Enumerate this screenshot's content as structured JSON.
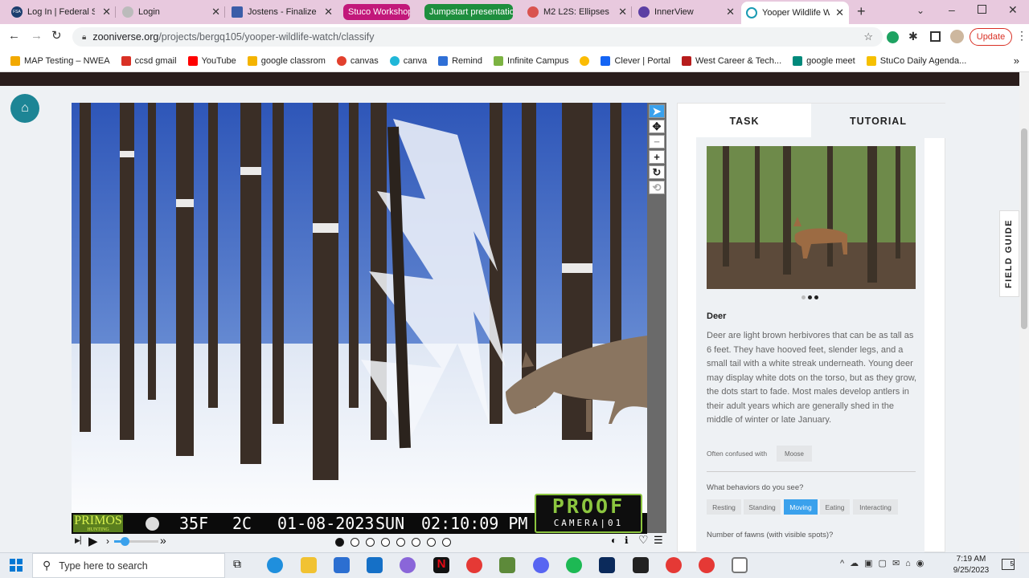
{
  "browser": {
    "tabs": [
      {
        "label": "Log In | Federal St",
        "fav_color": "#1b3e6e",
        "fav_text": "FSA"
      },
      {
        "label": "Login",
        "fav_color": "#9a9a9a"
      },
      {
        "label": "Jostens - Finalize C",
        "fav_color": "#3b5da8"
      },
      {
        "label": "M2 L2S: Ellipses",
        "fav_color": "#d9534f"
      },
      {
        "label": "InnerView",
        "fav_color": "#5b3fa3"
      },
      {
        "label": "Yooper Wildlife W",
        "fav_color": "#1a9bb3"
      }
    ],
    "groups": [
      {
        "label": "Stuco Workshop",
        "color": "#c2187a"
      },
      {
        "label": "Jumpstart presentatio",
        "color": "#1e8e3e"
      }
    ],
    "url_domain": "zooniverse.org",
    "url_path": "/projects/bergq105/yooper-wildlife-watch/classify",
    "update_label": "Update",
    "bookmarks": [
      {
        "label": "MAP Testing – NWEA",
        "color": "#f2a900"
      },
      {
        "label": "ccsd gmail",
        "color": "#d93025"
      },
      {
        "label": "YouTube",
        "color": "#ff0000"
      },
      {
        "label": "google classrom",
        "color": "#f4b400"
      },
      {
        "label": "canvas",
        "color": "#e2402d"
      },
      {
        "label": "canva",
        "color": "#20b7d8"
      },
      {
        "label": "Remind",
        "color": "#2f6fd6"
      },
      {
        "label": "Infinite Campus",
        "color": "#7cb342"
      },
      {
        "label": "",
        "color": "#fbbc05"
      },
      {
        "label": "Clever | Portal",
        "color": "#1464f4"
      },
      {
        "label": "West Career & Tech...",
        "color": "#b71c1c"
      },
      {
        "label": "google meet",
        "color": "#00897b"
      },
      {
        "label": "StuCo Daily Agenda...",
        "color": "#f6c000"
      }
    ]
  },
  "camera": {
    "brand": "PRIMOS",
    "brand_sub": "HUNTING",
    "temp_f": "35F",
    "temp_c": "2C",
    "date": "01-08-2023",
    "day": "SUN",
    "time": "02:10:09 PM",
    "proof_top": "PROOF",
    "proof_bottom": "CAMERA|01",
    "frames": 8,
    "current_frame": 1
  },
  "panel": {
    "tab_task": "TASK",
    "tab_tutorial": "TUTORIAL",
    "field_guide": "FIELD GUIDE",
    "animal_name": "Deer",
    "description": "Deer are light brown herbivores that can be as tall as 6 feet. They have hooved feet, slender legs, and a small tail with a white streak underneath. Young deer may display white dots on the torso, but as they grow, the dots start to fade. Most males develop antlers in their adult years which are generally shed in the middle of winter or late January.",
    "confused_label": "Often confused with",
    "confused_with": "Moose",
    "behaviors_question": "What behaviors do you see?",
    "behaviors": [
      "Resting",
      "Standing",
      "Moving",
      "Eating",
      "Interacting"
    ],
    "behavior_selected": "Moving",
    "fawns_question": "Number of fawns (with visible spots)?"
  },
  "taskbar": {
    "search_placeholder": "Type here to search",
    "time": "7:19 AM",
    "date": "9/25/2023",
    "notification_count": "5"
  }
}
